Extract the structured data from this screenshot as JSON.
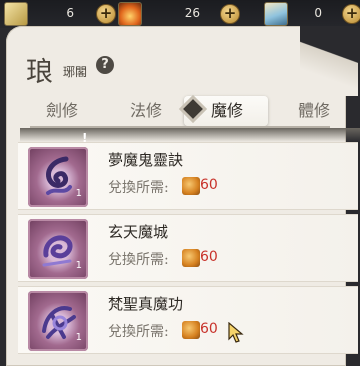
{
  "currencies": [
    {
      "icon": "scroll-book-icon",
      "value": "6",
      "color": "#e8d27a"
    },
    {
      "icon": "fire-book-icon",
      "value": "26",
      "color": "#e57a2b"
    },
    {
      "icon": "sea-book-icon",
      "value": "0",
      "color": "#7fb9d9"
    }
  ],
  "header": {
    "title_big": "琅",
    "title_small": "琊閣",
    "help": "?"
  },
  "tabs": [
    {
      "label": "劍修",
      "active": false
    },
    {
      "label": "法修",
      "active": false
    },
    {
      "label": "魔修",
      "active": true
    },
    {
      "label": "體修",
      "active": false
    }
  ],
  "alert_mark": "!",
  "items": [
    {
      "name": "夢魔鬼靈訣",
      "cost_label": "兌換所需:",
      "cost_value": "60",
      "count": "1"
    },
    {
      "name": "玄天魔城",
      "cost_label": "兌換所需:",
      "cost_value": "60",
      "count": "1"
    },
    {
      "name": "梵聖真魔功",
      "cost_label": "兌換所需:",
      "cost_value": "60",
      "count": "1"
    }
  ]
}
